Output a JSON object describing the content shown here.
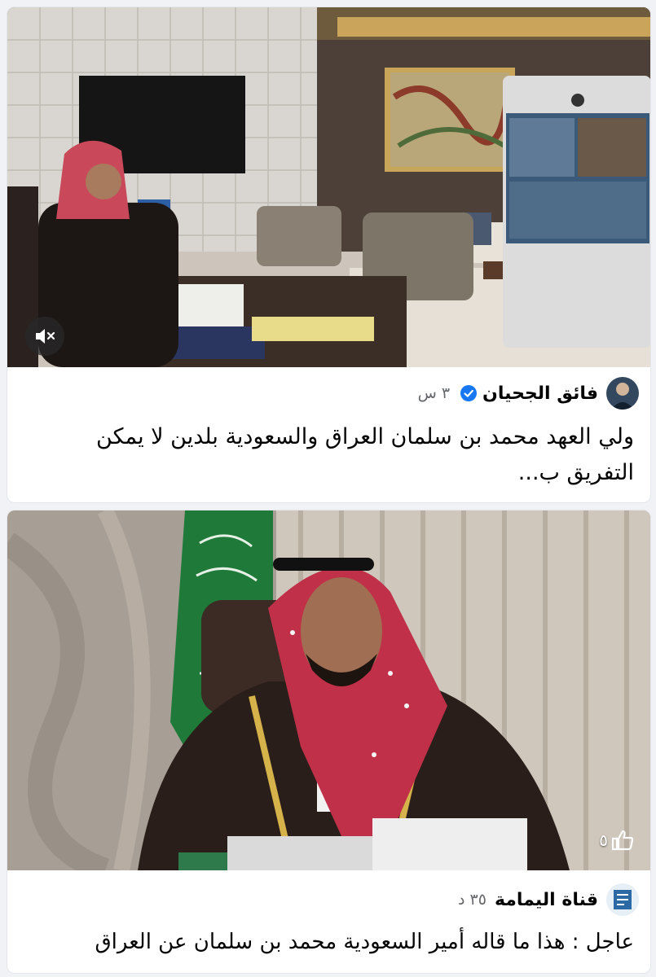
{
  "feed": {
    "posts": [
      {
        "author": "فائق الجحيان",
        "verified": true,
        "timestamp": "٣ س",
        "text": "ولي العهد محمد بن سلمان العراق والسعودية بلدين لا يمكن التفريق ب...",
        "media_icon": "mute-speaker-icon",
        "avatar_icon": "user-avatar-icon"
      },
      {
        "author": "قناة اليمامة",
        "verified": false,
        "timestamp": "٣٥ د",
        "text": "عاجل : هذا ما قاله  أمير السعودية محمد بن سلمان عن العراق",
        "like_count": "٥",
        "media_icon": "thumbs-up-icon",
        "avatar_icon": "channel-logo-icon"
      }
    ]
  },
  "colors": {
    "verified_badge": "#1877f2",
    "text_primary": "#050505",
    "text_secondary": "#65676b",
    "background": "#f0f2f5"
  }
}
